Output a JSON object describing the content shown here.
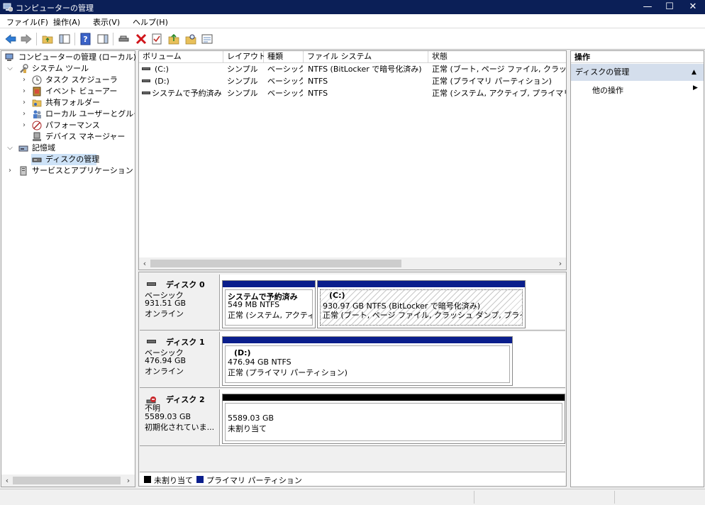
{
  "window": {
    "title": "コンピューターの管理",
    "minimize": "—",
    "maximize": "☐",
    "close": "✕"
  },
  "menu": [
    "ファイル(F)",
    "操作(A)",
    "表示(V)",
    "ヘルプ(H)"
  ],
  "toolbar_icons": [
    "back-icon",
    "forward-icon",
    "up-folder-icon",
    "show-hide-tree-icon",
    "help-icon",
    "show-hide-action-icon",
    "connect-icon",
    "delete-icon",
    "properties-icon",
    "import-icon",
    "search-icon",
    "rescan-icon"
  ],
  "tree": {
    "root": "コンピューターの管理 (ローカル)",
    "system_tools": "システム ツール",
    "task_scheduler": "タスク スケジューラ",
    "event_viewer": "イベント ビューアー",
    "shared_folders": "共有フォルダー",
    "local_users": "ローカル ユーザーとグループ",
    "performance": "パフォーマンス",
    "device_manager": "デバイス マネージャー",
    "storage": "記憶域",
    "disk_management": "ディスクの管理",
    "services": "サービスとアプリケーション"
  },
  "volume_table": {
    "columns": [
      "ボリューム",
      "レイアウト",
      "種類",
      "ファイル システム",
      "状態"
    ],
    "rows": [
      [
        "(C:)",
        "シンプル",
        "ベーシック",
        "NTFS (BitLocker で暗号化済み)",
        "正常 (ブート, ページ ファイル, クラッシュ ダ"
      ],
      [
        "(D:)",
        "シンプル",
        "ベーシック",
        "NTFS",
        "正常 (プライマリ パーティション)"
      ],
      [
        "システムで予約済み",
        "シンプル",
        "ベーシック",
        "NTFS",
        "正常 (システム, アクティブ, プライマリ パー"
      ]
    ]
  },
  "disks": [
    {
      "name": "ディスク 0",
      "type": "ベーシック",
      "size": "931.51 GB",
      "status": "オンライン",
      "partitions": [
        {
          "title": "システムで予約済み",
          "size": "549 MB NTFS",
          "status": "正常 (システム, アクティブ"
        },
        {
          "title": "(C:)",
          "size": "930.97 GB NTFS (BitLocker で暗号化済み)",
          "status": "正常 (ブート, ページ ファイル, クラッシュ ダンプ, プライマリ パ"
        }
      ]
    },
    {
      "name": "ディスク 1",
      "type": "ベーシック",
      "size": "476.94 GB",
      "status": "オンライン",
      "partitions": [
        {
          "title": "(D:)",
          "size": "476.94 GB NTFS",
          "status": "正常 (プライマリ パーティション)"
        }
      ]
    },
    {
      "name": "ディスク 2",
      "type": "不明",
      "size": "5589.03 GB",
      "status": "初期化されていま...",
      "partitions": [
        {
          "title": "",
          "size": "5589.03 GB",
          "status": "未割り当て"
        }
      ]
    }
  ],
  "legend": {
    "unallocated": "未割り当て",
    "primary": "プライマリ パーティション",
    "unallocated_color": "#000000",
    "primary_color": "#0a1e8c"
  },
  "actions": {
    "header": "操作",
    "section": "ディスクの管理",
    "more": "他の操作"
  }
}
